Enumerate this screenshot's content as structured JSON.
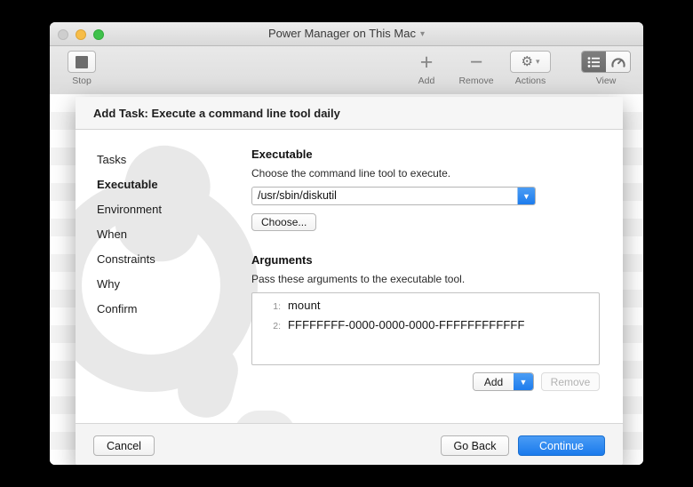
{
  "window": {
    "title": "Power Manager on This Mac",
    "title_chevron_icon": "chevron-down-icon",
    "traffic_lights": [
      "close",
      "minimize",
      "zoom"
    ]
  },
  "toolbar": {
    "items": [
      {
        "label": "Stop",
        "icon": "stop-square-icon"
      },
      {
        "label": "Add",
        "icon": "plus-icon"
      },
      {
        "label": "Remove",
        "icon": "minus-icon"
      },
      {
        "label": "Actions",
        "icon": "gear-icon",
        "chevron": "chevron-down-icon"
      },
      {
        "label": "View",
        "icon": "segmented-view-control"
      }
    ],
    "view_segments": [
      {
        "icon": "list-view-icon",
        "selected": true
      },
      {
        "icon": "gauge-view-icon",
        "selected": false
      }
    ]
  },
  "sheet": {
    "title": "Add Task: Execute a command line tool daily",
    "steps": [
      {
        "label": "Tasks",
        "active": false
      },
      {
        "label": "Executable",
        "active": true
      },
      {
        "label": "Environment",
        "active": false
      },
      {
        "label": "When",
        "active": false
      },
      {
        "label": "Constraints",
        "active": false
      },
      {
        "label": "Why",
        "active": false
      },
      {
        "label": "Confirm",
        "active": false
      }
    ],
    "executable": {
      "heading": "Executable",
      "description": "Choose the command line tool to execute.",
      "combo_value": "/usr/sbin/diskutil",
      "combo_arrow_icon": "chevron-down-icon",
      "choose_button": "Choose..."
    },
    "arguments": {
      "heading": "Arguments",
      "description": "Pass these arguments to the executable tool.",
      "rows": [
        {
          "index": "1:",
          "value": "mount"
        },
        {
          "index": "2:",
          "value": "FFFFFFFF-0000-0000-0000-FFFFFFFFFFFF"
        }
      ],
      "add_button": "Add",
      "add_arrow_icon": "chevron-down-icon",
      "remove_button": "Remove"
    },
    "footer": {
      "cancel": "Cancel",
      "go_back": "Go Back",
      "continue": "Continue"
    }
  },
  "colors": {
    "accent_blue": "#1a7aec",
    "sheet_header": "#f6f6f6",
    "watermark_gray": "#e6e6e6"
  }
}
